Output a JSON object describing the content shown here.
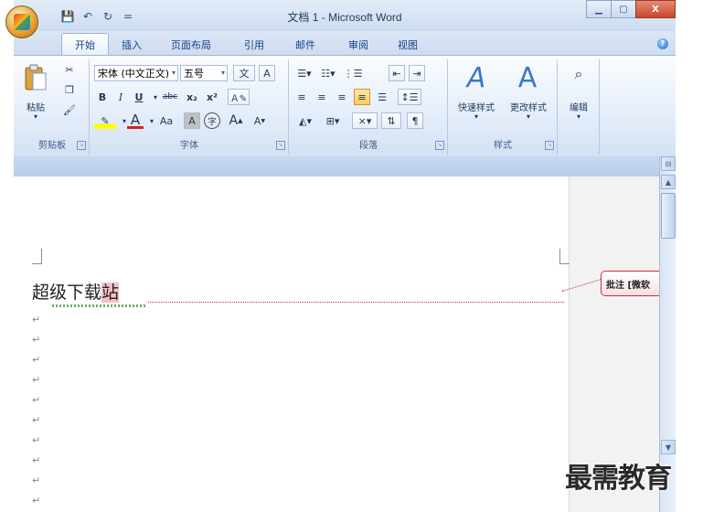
{
  "window": {
    "title": "文档 1 - Microsoft Word",
    "close_label": "X"
  },
  "qat": {
    "save_glyph": "💾",
    "undo_glyph": "↶",
    "redo_glyph": "↻",
    "more_glyph": "="
  },
  "tabs": [
    {
      "label": "开始",
      "active": true
    },
    {
      "label": "插入"
    },
    {
      "label": "页面布局"
    },
    {
      "label": "引用"
    },
    {
      "label": "邮件"
    },
    {
      "label": "审阅"
    },
    {
      "label": "视图"
    }
  ],
  "ribbon": {
    "clipboard": {
      "label": "剪贴板",
      "paste_label": "粘贴"
    },
    "font": {
      "label": "字体",
      "font_name": "宋体 (中文正文)",
      "font_size": "五号",
      "bold": "B",
      "italic": "I",
      "underline": "U",
      "strike": "abc",
      "sub": "x₂",
      "sup": "x²",
      "grow": "A",
      "shrink": "A",
      "aa": "Aa",
      "phonetic": "文",
      "border_char": "A",
      "circle": "字"
    },
    "paragraph": {
      "label": "段落"
    },
    "styles": {
      "label": "样式",
      "quick_styles": "快速样式",
      "change_styles": "更改样式"
    },
    "editing": {
      "label": "编辑",
      "find_glyph": "⌕"
    }
  },
  "document": {
    "text_plain": "超级下载",
    "text_highlight": "站",
    "comment": "批注 [微软",
    "paragraph_mark": "↵"
  },
  "watermark": "最需教育",
  "colors": {
    "accent": "#15428b",
    "comment_border": "#c7303a",
    "highlight": "#f5c0c6"
  }
}
